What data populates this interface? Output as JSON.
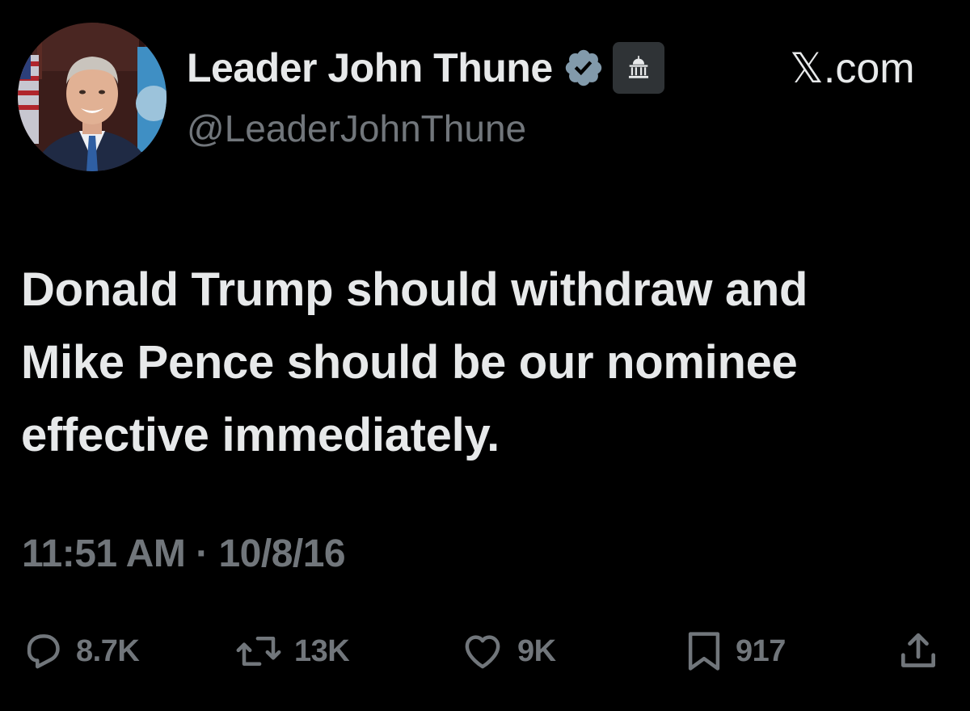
{
  "author": {
    "display_name": "Leader John Thune",
    "handle": "@LeaderJohnThune",
    "verified_badge_icon": "verified-badge-icon",
    "verified_badge_color": "#71767b",
    "affiliation_icon": "capitol-building-icon"
  },
  "source": {
    "label": "𝕏.com"
  },
  "tweet": {
    "text_lines": [
      "Donald Trump should withdraw and",
      "Mike Pence should be our nominee",
      "effective immediately."
    ],
    "timestamp": "11:51 AM · 10/8/16"
  },
  "actions": {
    "reply": {
      "icon": "reply-icon",
      "count": "8.7K"
    },
    "repost": {
      "icon": "repost-icon",
      "count": "13K"
    },
    "like": {
      "icon": "heart-icon",
      "count": "9K"
    },
    "bookmark": {
      "icon": "bookmark-icon",
      "count": "917"
    },
    "share": {
      "icon": "share-icon"
    }
  },
  "colors": {
    "background": "#000000",
    "primary_text": "#e7e9ea",
    "secondary_text": "#71767b",
    "badge_background": "#2f3336"
  }
}
